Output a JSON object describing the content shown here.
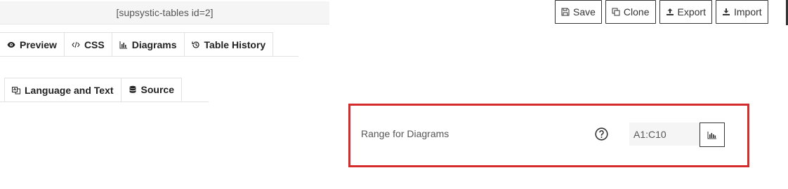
{
  "shortcode": "[supsystic-tables id=2]",
  "toolbar": {
    "save": "Save",
    "clone": "Clone",
    "export": "Export",
    "import": "Import"
  },
  "tabs_row1": [
    {
      "label": "Preview",
      "icon": "eye-icon"
    },
    {
      "label": "CSS",
      "icon": "code-icon"
    },
    {
      "label": "Diagrams",
      "icon": "bar-chart-icon"
    },
    {
      "label": "Table History",
      "icon": "history-icon"
    }
  ],
  "tabs_row2": [
    {
      "label": "Language and Text",
      "icon": "language-icon"
    },
    {
      "label": "Source",
      "icon": "database-icon",
      "active": true
    }
  ],
  "range": {
    "label": "Range for Diagrams",
    "value": "A1:C10",
    "help_icon": "question-circle-icon",
    "button_icon": "bar-chart-icon"
  },
  "colors": {
    "highlight": "#d62b2b",
    "input_bg": "#f5f5f5"
  }
}
